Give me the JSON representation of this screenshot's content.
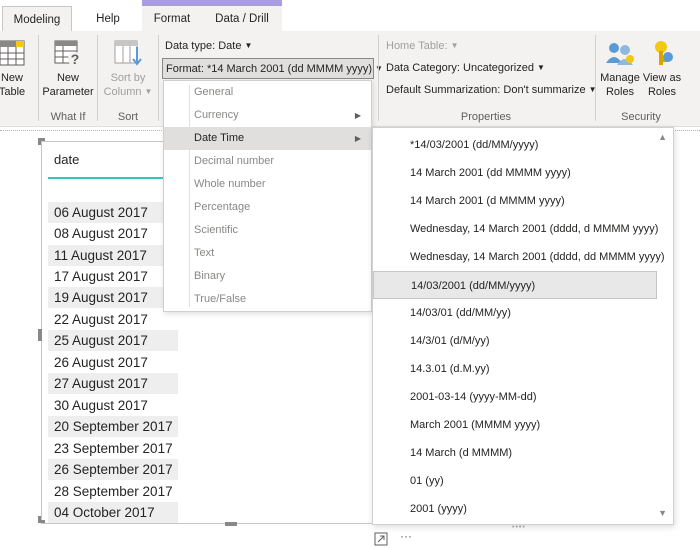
{
  "tabs": {
    "modeling": "Modeling",
    "help": "Help",
    "format": "Format",
    "data_drill": "Data / Drill"
  },
  "ribbon": {
    "new_table": [
      "New",
      "Table"
    ],
    "new_parameter": [
      "New",
      "Parameter"
    ],
    "sort_by_column": [
      "Sort by",
      "Column"
    ],
    "groups": {
      "what_if": "What If",
      "sort": "Sort",
      "properties": "Properties",
      "security": "Security"
    },
    "data_type": "Data type: Date",
    "format": "Format: *14 March 2001 (dd MMMM yyyy)",
    "home_table": "Home Table:",
    "data_category": "Data Category: Uncategorized",
    "default_summarization": "Default Summarization: Don't summarize",
    "manage_roles": [
      "Manage",
      "Roles"
    ],
    "view_as_roles": [
      "View as",
      "Roles"
    ]
  },
  "table": {
    "column_header": "date",
    "rows": [
      "06 August 2017",
      "08 August 2017",
      "11 August 2017",
      "17 August 2017",
      "19 August 2017",
      "22 August 2017",
      "25 August 2017",
      "26 August 2017",
      "27 August 2017",
      "30 August 2017",
      "20 September 2017",
      "23 September 2017",
      "26 September 2017",
      "28 September 2017",
      "04 October 2017"
    ]
  },
  "format_menu": {
    "items": [
      "General",
      "Currency",
      "Date Time",
      "Decimal number",
      "Whole number",
      "Percentage",
      "Scientific",
      "Text",
      "Binary",
      "True/False"
    ],
    "highlighted": "Date Time"
  },
  "date_time_menu": {
    "items": [
      "*14/03/2001 (dd/MM/yyyy)",
      "14 March 2001 (dd MMMM yyyy)",
      "14 March 2001 (d MMMM yyyy)",
      "Wednesday, 14 March 2001 (dddd, d MMMM yyyy)",
      "Wednesday, 14 March 2001 (dddd, dd MMMM yyyy)",
      "14/03/2001 (dd/MM/yyyy)",
      "14/03/01 (dd/MM/yy)",
      "14/3/01 (d/M/yy)",
      "14.3.01 (d.M.yy)",
      "2001-03-14 (yyyy-MM-dd)",
      "March 2001 (MMMM yyyy)",
      "14 March (d MMMM)",
      "01 (yy)",
      "2001 (yyyy)"
    ],
    "highlighted": "14/03/2001 (dd/MM/yyyy)"
  },
  "icons": {
    "caret": "caret-down-icon",
    "submenu": "chevron-right-icon",
    "focus_mode": "focus-mode-icon",
    "more_options": "more-options-icon"
  },
  "colors": {
    "accent_band": "#a99de0",
    "header_underline": "#3ec2b4",
    "ribbon_bg": "#f3f2f1"
  },
  "glyphs": {
    "caret": "▼",
    "submenu": "▶",
    "scroll_up": "▲",
    "scroll_down": "▼",
    "grip": "••••",
    "ellipsis": "···"
  }
}
